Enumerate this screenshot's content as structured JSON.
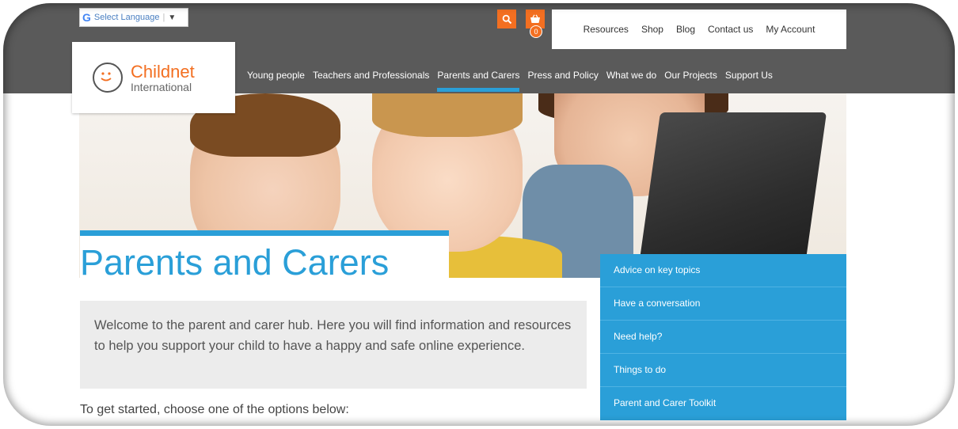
{
  "translate": {
    "label": "Select Language",
    "google_letter": "G",
    "arrow": "▼"
  },
  "header": {
    "cart_count": "0",
    "top_links": [
      "Resources",
      "Shop",
      "Blog",
      "Contact us",
      "My Account"
    ]
  },
  "logo": {
    "name": "Childnet",
    "sub": "International"
  },
  "main_nav": {
    "items": [
      "Young people",
      "Teachers and Professionals",
      "Parents and Carers",
      "Press and Policy",
      "What we do",
      "Our Projects",
      "Support Us"
    ],
    "active": "Parents and Carers"
  },
  "page": {
    "title": "Parents and Carers",
    "welcome": "Welcome to the parent and carer hub. Here you will find information and resources to help you support your child to have a happy and safe online experience.",
    "get_started": "To get started, choose one of the options below:"
  },
  "side_menu": {
    "items": [
      "Advice on key topics",
      "Have a conversation",
      "Need help?",
      "Things to do",
      "Parent and Carer Toolkit"
    ]
  },
  "colors": {
    "brand_orange": "#f36f21",
    "brand_blue": "#2a9fd8",
    "header_grey": "#5a5a5a"
  }
}
